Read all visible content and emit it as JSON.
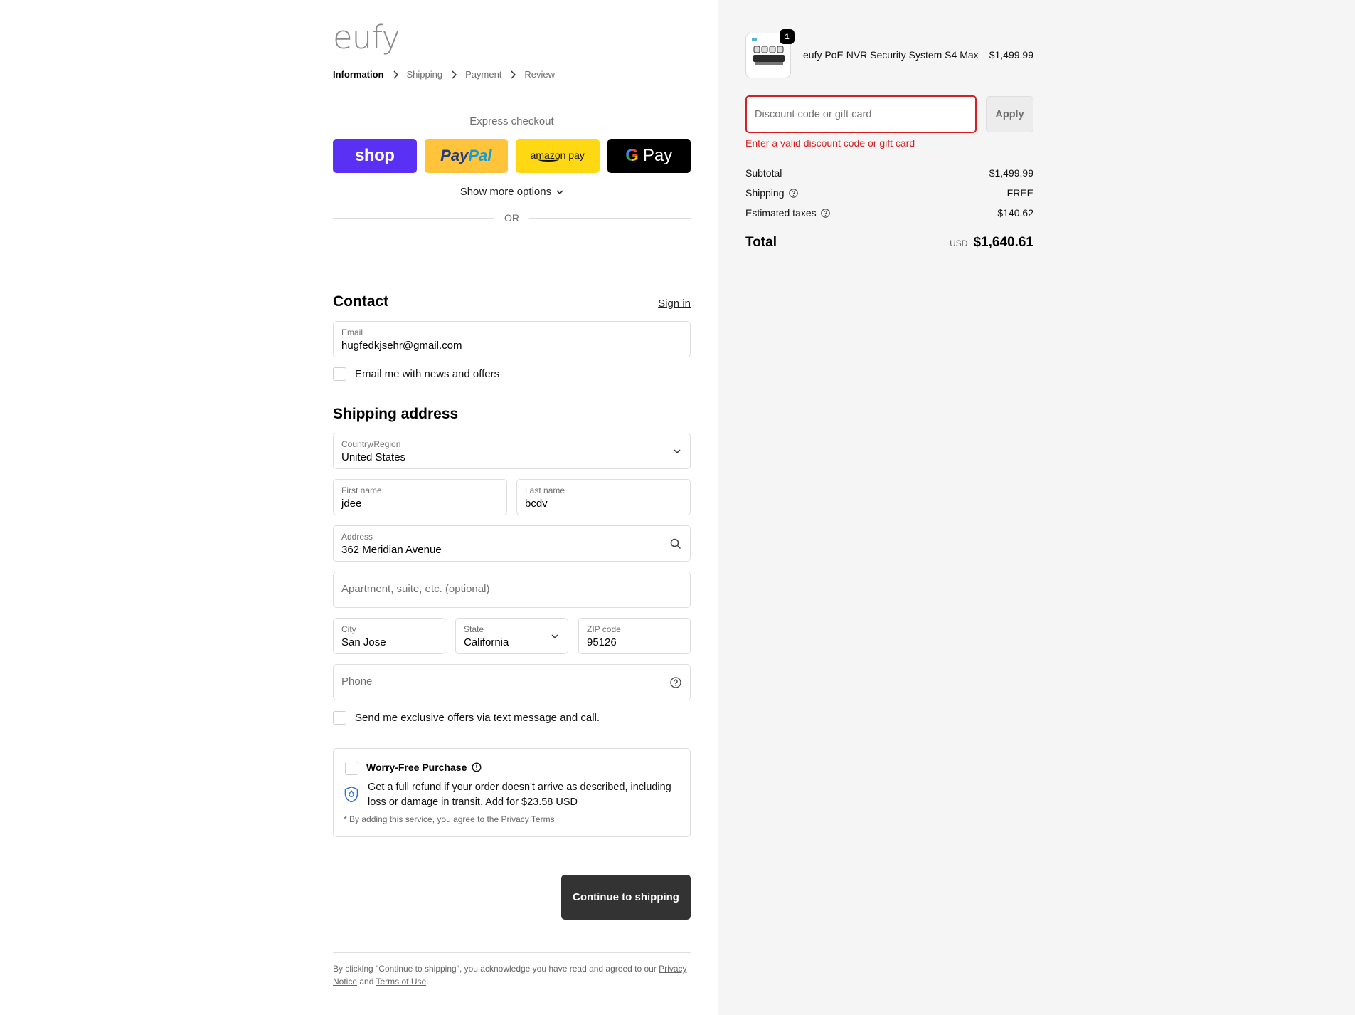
{
  "brand": {
    "logo_text": "eufy"
  },
  "breadcrumb": [
    "Information",
    "Shipping",
    "Payment",
    "Review"
  ],
  "express": {
    "title": "Express checkout",
    "shop_label": "shop",
    "paypal_label_1": "Pay",
    "paypal_label_2": "Pal",
    "amazon_label": "amazon pay",
    "gpay_label": "Pay",
    "more_options": "Show more options",
    "or": "OR"
  },
  "contact": {
    "heading": "Contact",
    "signin": "Sign in",
    "email_label": "Email",
    "email_value": "hugfedkjsehr@gmail.com",
    "news_label": "Email me with news and offers"
  },
  "shipping": {
    "heading": "Shipping address",
    "country_label": "Country/Region",
    "country_value": "United States",
    "first_label": "First name",
    "first_value": "jdee",
    "last_label": "Last name",
    "last_value": "bcdv",
    "address_label": "Address",
    "address_value": "362 Meridian Avenue",
    "apt_placeholder": "Apartment, suite, etc. (optional)",
    "city_label": "City",
    "city_value": "San Jose",
    "state_label": "State",
    "state_value": "California",
    "zip_label": "ZIP code",
    "zip_value": "95126",
    "phone_placeholder": "Phone",
    "sms_label": "Send me exclusive offers via text message and call."
  },
  "worry": {
    "title": "Worry-Free Purchase",
    "desc": "Get a full refund if your order doesn't arrive as described, including loss or damage in transit. Add for $23.58 USD",
    "note": "* By adding this service, you agree to the Privacy Terms"
  },
  "continue_label": "Continue to shipping",
  "legal": {
    "prefix": "By clicking \"Continue to shipping\", you acknowledge you have read and agreed to our ",
    "privacy": "Privacy Notice",
    "and": " and ",
    "terms": "Terms of Use",
    "suffix": "."
  },
  "order": {
    "quantity": "1",
    "product_name": "eufy PoE NVR Security System S4 Max",
    "product_price": "$1,499.99",
    "discount_placeholder": "Discount code or gift card",
    "apply_label": "Apply",
    "error": "Enter a valid discount code or gift card",
    "subtotal_label": "Subtotal",
    "subtotal_value": "$1,499.99",
    "shipping_label": "Shipping",
    "shipping_value": "FREE",
    "taxes_label": "Estimated taxes",
    "taxes_value": "$140.62",
    "total_label": "Total",
    "currency": "USD",
    "total_value": "$1,640.61"
  },
  "colors": {
    "shop": "#5a31f4",
    "paypal": "#ffc439",
    "amazon": "#ffd814",
    "gpay": "#000000",
    "error": "#d61f1f",
    "primary_button": "#333333"
  }
}
